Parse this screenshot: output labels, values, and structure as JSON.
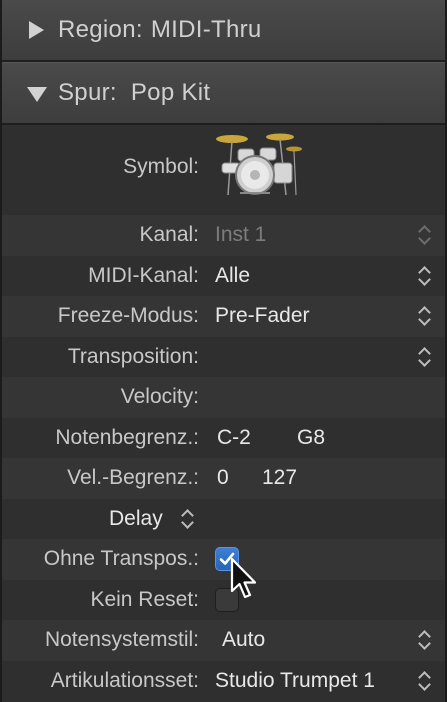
{
  "header_region": {
    "label": "Region:",
    "value": "MIDI-Thru"
  },
  "header_track": {
    "label": "Spur:",
    "value": "Pop Kit"
  },
  "symbol": {
    "label": "Symbol:",
    "icon": "drum-kit-icon"
  },
  "rows": {
    "kanal": {
      "label": "Kanal:",
      "value": "Inst 1"
    },
    "midi_kanal": {
      "label": "MIDI-Kanal:",
      "value": "Alle"
    },
    "freeze": {
      "label": "Freeze-Modus:",
      "value": "Pre-Fader"
    },
    "transposition": {
      "label": "Transposition:",
      "value": ""
    },
    "velocity": {
      "label": "Velocity:",
      "value": ""
    },
    "notenbegrenz": {
      "label": "Notenbegrenz.:",
      "low": "C-2",
      "high": "G8"
    },
    "velbegrenz": {
      "label": "Vel.-Begrenz.:",
      "low": "0",
      "high": "127"
    },
    "delay": {
      "label": "Delay"
    },
    "ohne_transpos": {
      "label": "Ohne Transpos.:",
      "checked": true
    },
    "kein_reset": {
      "label": "Kein Reset:",
      "checked": false
    },
    "notensystemstil": {
      "label": "Notensystemstil:",
      "value": "Auto"
    },
    "artikulationsset": {
      "label": "Artikulationsset:",
      "value": "Studio Trumpet 1"
    }
  },
  "colors": {
    "panel": "#2f2f2f",
    "header": "#444444",
    "accent": "#3a79d2",
    "text": "#e8e8e8"
  }
}
